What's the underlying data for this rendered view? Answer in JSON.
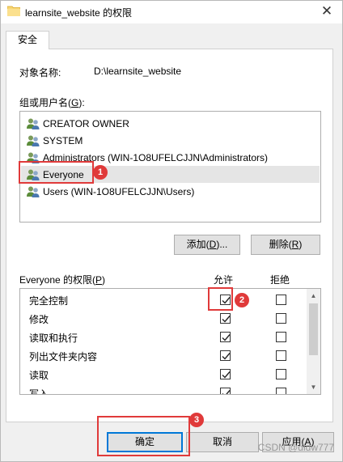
{
  "window": {
    "title": "learnsite_website 的权限",
    "close_glyph": "✕"
  },
  "tabs": [
    {
      "label": "安全",
      "active": true
    }
  ],
  "object": {
    "label": "对象名称:",
    "value": "D:\\learnsite_website"
  },
  "groups": {
    "label": "组或用户名(G):",
    "items": [
      {
        "name": "CREATOR OWNER",
        "selected": false,
        "icon": "users-icon"
      },
      {
        "name": "SYSTEM",
        "selected": false,
        "icon": "users-icon"
      },
      {
        "name": "Administrators (WIN-1O8UFELCJJN\\Administrators)",
        "selected": false,
        "icon": "users-icon"
      },
      {
        "name": "Everyone",
        "selected": true,
        "icon": "users-icon"
      },
      {
        "name": "Users (WIN-1O8UFELCJJN\\Users)",
        "selected": false,
        "icon": "users-icon"
      }
    ]
  },
  "buttons": {
    "add": "添加(D)...",
    "remove": "删除(R)",
    "ok": "确定",
    "cancel": "取消",
    "apply": "应用(A)"
  },
  "permissions": {
    "label": "Everyone 的权限(P)",
    "allow_header": "允许",
    "deny_header": "拒绝",
    "rows": [
      {
        "name": "完全控制",
        "allow": true,
        "deny": false
      },
      {
        "name": "修改",
        "allow": true,
        "deny": false
      },
      {
        "name": "读取和执行",
        "allow": true,
        "deny": false
      },
      {
        "name": "列出文件夹内容",
        "allow": true,
        "deny": false
      },
      {
        "name": "读取",
        "allow": true,
        "deny": false
      },
      {
        "name": "写入",
        "allow": true,
        "deny": false
      }
    ]
  },
  "annotations": {
    "badge1": "1",
    "badge2": "2",
    "badge3": "3",
    "color": "#e03a3a"
  },
  "watermark": "CSDN @dldw777"
}
